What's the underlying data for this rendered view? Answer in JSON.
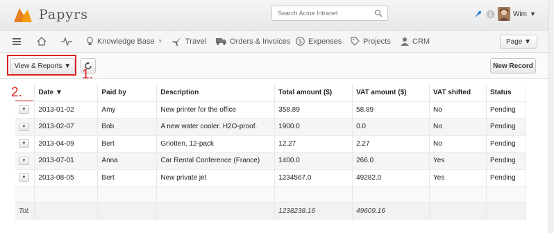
{
  "app": {
    "name": "Papyrs"
  },
  "search": {
    "placeholder": "Search Acme Intranet"
  },
  "user": {
    "name": "Wim"
  },
  "nav": {
    "items": [
      {
        "label": "",
        "icon": "home-icon"
      },
      {
        "label": "",
        "icon": "activity-icon"
      },
      {
        "label": "Knowledge Base",
        "icon": "lightbulb-icon"
      },
      {
        "label": "Travel",
        "icon": "plane-icon"
      },
      {
        "label": "Orders & Invoices",
        "icon": "truck-icon"
      },
      {
        "label": "Expenses",
        "icon": "dollar-icon"
      },
      {
        "label": "Projects",
        "icon": "tag-icon"
      },
      {
        "label": "CRM",
        "icon": "person-icon"
      }
    ],
    "page_button": "Page ▼"
  },
  "toolbar": {
    "view_reports": "View & Reports ▼",
    "new_record": "New Record"
  },
  "annotations": {
    "one": "1.",
    "two": "2."
  },
  "table": {
    "headers": [
      "",
      "Date ▼",
      "Paid by",
      "Description",
      "Total amount ($)",
      "VAT amount ($)",
      "VAT shifted",
      "Status"
    ],
    "rows": [
      [
        "▼",
        "2013-01-02",
        "Amy",
        "New printer for the office",
        "358.89",
        "58.89",
        "No",
        "Pending"
      ],
      [
        "▼",
        "2013-02-07",
        "Bob",
        "A new water cooler. H2O-proof.",
        "1900.0",
        "0.0",
        "No",
        "Pending"
      ],
      [
        "▼",
        "2013-04-09",
        "Bert",
        "Griotten, 12-pack",
        "12.27",
        "2.27",
        "No",
        "Pending"
      ],
      [
        "▼",
        "2013-07-01",
        "Anna",
        "Car Rental Conference (France)",
        "1400.0",
        "266.0",
        "Yes",
        "Pending"
      ],
      [
        "▼",
        "2013-08-05",
        "Bert",
        "New private jet",
        "1234567.0",
        "49282.0",
        "Yes",
        "Pending"
      ]
    ],
    "footer": {
      "label": "Tot.",
      "total": "1238238.16",
      "vat": "49609.16"
    }
  },
  "colors": {
    "accent_red": "#e02020",
    "logo_orange": "#f39c12"
  }
}
